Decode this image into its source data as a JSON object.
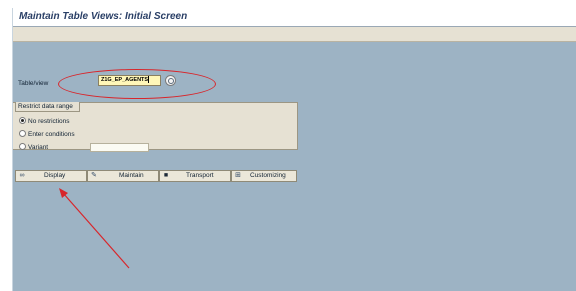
{
  "window": {
    "title": "Maintain Table Views: Initial Screen"
  },
  "tableview": {
    "label": "Table/view",
    "value": "Z1G_EP_AGENTS"
  },
  "restrict": {
    "group_title": "Restrict data range",
    "options": [
      {
        "label": "No restrictions",
        "selected": true
      },
      {
        "label": "Enter conditions",
        "selected": false
      },
      {
        "label": "Variant",
        "selected": false
      }
    ],
    "variant_value": ""
  },
  "actions": [
    {
      "label": "Display",
      "icon": "glasses-icon"
    },
    {
      "label": "Maintain",
      "icon": "pencil-icon"
    },
    {
      "label": "Transport",
      "icon": "truck-icon"
    },
    {
      "label": "Customizing",
      "icon": "customizing-icon"
    }
  ],
  "annotation_colors": {
    "highlight": "#d8262b"
  }
}
